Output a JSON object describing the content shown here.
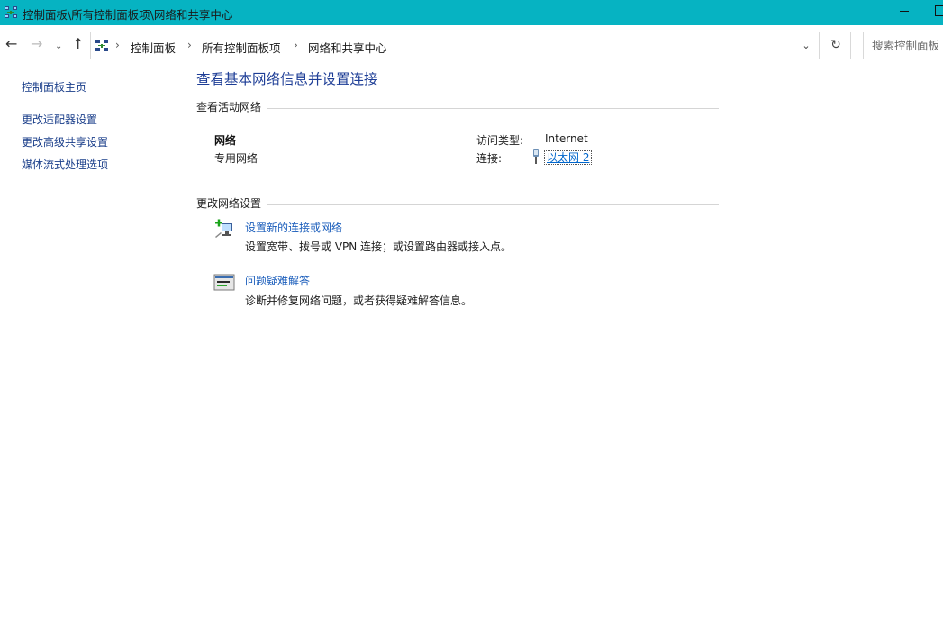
{
  "window": {
    "title": "控制面板\\所有控制面板项\\网络和共享中心"
  },
  "address": {
    "breadcrumbs": [
      "控制面板",
      "所有控制面板项",
      "网络和共享中心"
    ],
    "separator": "›",
    "search_placeholder": "搜索控制面板"
  },
  "nav": {
    "back": "←",
    "forward": "→",
    "recent": "⌄",
    "up": "↑",
    "dropdown": "⌄",
    "refresh": "↻"
  },
  "sidebar": {
    "items": [
      {
        "label": "控制面板主页"
      },
      {
        "label": "更改适配器设置"
      },
      {
        "label": "更改高级共享设置"
      },
      {
        "label": "媒体流式处理选项"
      }
    ]
  },
  "main": {
    "title": "查看基本网络信息并设置连接",
    "active_section": "查看活动网络",
    "network": {
      "name": "网络",
      "type": "专用网络",
      "access_label": "访问类型:",
      "access_value": "Internet",
      "connection_label": "连接:",
      "connection_value": "以太网 2"
    },
    "change_section": "更改网络设置",
    "tasks": [
      {
        "link": "设置新的连接或网络",
        "desc": "设置宽带、拨号或 VPN 连接；或设置路由器或接入点。",
        "icon": "new-connection-icon"
      },
      {
        "link": "问题疑难解答",
        "desc": "诊断并修复网络问题，或者获得疑难解答信息。",
        "icon": "troubleshoot-icon"
      }
    ]
  },
  "colors": {
    "titlebar": "#06b3c2",
    "link": "#1a3e8a",
    "heading": "#1d3d96"
  }
}
